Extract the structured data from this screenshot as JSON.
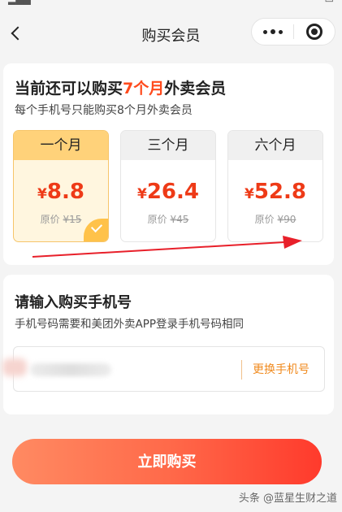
{
  "nav": {
    "title": "购买会员"
  },
  "membership": {
    "title_prefix": "当前还可以购买",
    "title_highlight": "7个月",
    "title_suffix": "外卖会员",
    "subtitle": "每个手机号只能购买8个月外卖会员",
    "plans": [
      {
        "label": "一个月",
        "currency": "¥",
        "price": "8.8",
        "orig_label": "原价",
        "orig_price": "¥15",
        "selected": true
      },
      {
        "label": "三个月",
        "currency": "¥",
        "price": "26.4",
        "orig_label": "原价",
        "orig_price": "¥45",
        "selected": false
      },
      {
        "label": "六个月",
        "currency": "¥",
        "price": "52.8",
        "orig_label": "原价",
        "orig_price": "¥90",
        "selected": false
      }
    ]
  },
  "phone": {
    "title": "请输入购买手机号",
    "subtitle": "手机号码需要和美团外卖APP登录手机号码相同",
    "change_label": "更换手机号"
  },
  "buy": {
    "label": "立即购买"
  },
  "watermark": "头条 @蓝星生财之道",
  "colors": {
    "accent": "#ff4a1c",
    "selected_head": "#ffd27a",
    "selected_bg": "#fff6df",
    "button_start": "#ff8a62",
    "button_end": "#ff3a2c",
    "change_link": "#f08a1e"
  }
}
